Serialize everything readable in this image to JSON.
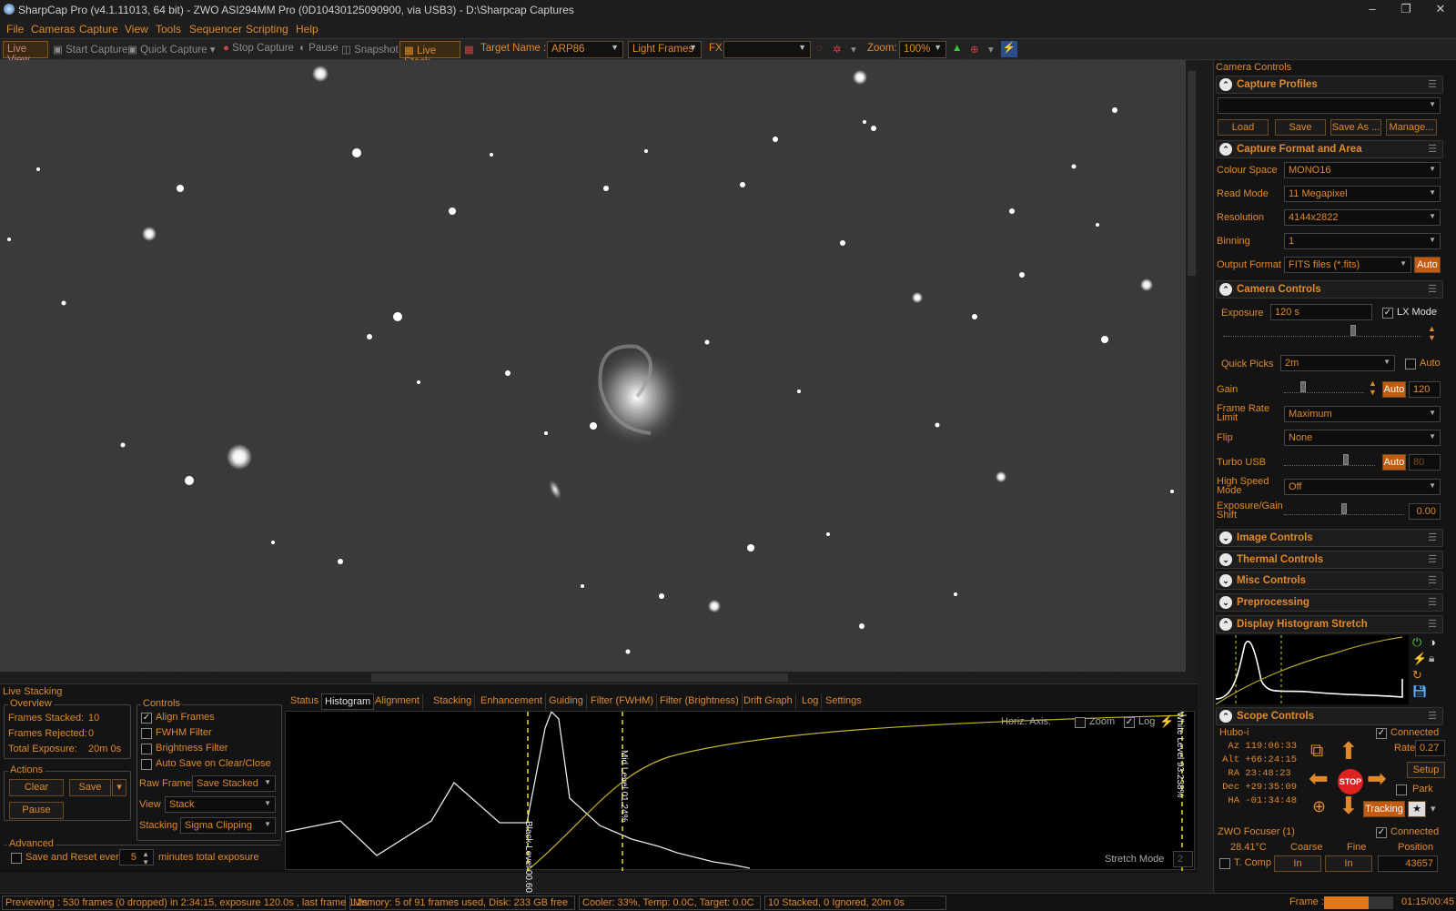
{
  "window": {
    "title": "SharpCap Pro (v4.1.11013, 64 bit) - ZWO ASI294MM Pro (0D10430125090900, via USB3) - D:\\Sharpcap Captures"
  },
  "menu": [
    "File",
    "Cameras",
    "Capture",
    "View",
    "Tools",
    "Sequencer",
    "Scripting",
    "Help"
  ],
  "toolbar": {
    "live_view": "Live View",
    "start_capture": "Start Capture",
    "quick_capture": "Quick Capture",
    "stop_capture": "Stop Capture",
    "pause": "Pause",
    "snapshot": "Snapshot",
    "live_stack": "Live Stack",
    "target_label": "Target Name :",
    "target_value": "ARP86",
    "frame_type": "Light Frames",
    "fx_label": "FX",
    "fx_value": "",
    "zoom_label": "Zoom:",
    "zoom_value": "100%"
  },
  "right_panel": {
    "title": "Camera Controls",
    "capture_profiles": {
      "title": "Capture Profiles",
      "profile_value": "",
      "load": "Load",
      "save": "Save",
      "save_as": "Save As ...",
      "manage": "Manage..."
    },
    "capture_format": {
      "title": "Capture Format and Area",
      "colour_space_label": "Colour Space",
      "colour_space": "MONO16",
      "read_mode_label": "Read Mode",
      "read_mode": "11 Megapixel",
      "resolution_label": "Resolution",
      "resolution": "4144x2822",
      "binning_label": "Binning",
      "binning": "1",
      "output_format_label": "Output Format",
      "output_format": "FITS files (*.fits)",
      "auto": "Auto"
    },
    "camera_controls": {
      "title": "Camera Controls",
      "exposure_label": "Exposure",
      "exposure": "120 s",
      "lx_mode": "LX Mode",
      "quick_picks_label": "Quick Picks",
      "quick_picks": "2m",
      "quick_auto": "Auto",
      "gain_label": "Gain",
      "gain_auto": "Auto",
      "gain": "120",
      "frame_rate_label": "Frame Rate Limit",
      "frame_rate": "Maximum",
      "flip_label": "Flip",
      "flip": "None",
      "turbo_label": "Turbo USB",
      "turbo_auto": "Auto",
      "turbo": "80",
      "high_speed_label": "High Speed Mode",
      "high_speed": "Off",
      "shift_label": "Exposure/Gain Shift",
      "shift": "0.00"
    },
    "sections": {
      "image": "Image Controls",
      "thermal": "Thermal Controls",
      "misc": "Misc Controls",
      "preproc": "Preprocessing",
      "histogram": "Display Histogram Stretch",
      "scope": "Scope Controls"
    },
    "scope": {
      "mount": "Hubo-i",
      "connected": "Connected",
      "az_label": "Az",
      "az": "119:06:33",
      "alt_label": "Alt",
      "alt": "+66:24:15",
      "ra_label": "RA",
      "ra": "23:48:23",
      "dec_label": "Dec",
      "dec": "+29:35:09",
      "ha_label": "HA",
      "ha": "-01:34:48",
      "rate_label": "Rate:",
      "rate": "0.27",
      "setup": "Setup",
      "park": "Park",
      "tracking": "Tracking",
      "stop": "STOP"
    },
    "focuser": {
      "name": "ZWO Focuser (1)",
      "connected": "Connected",
      "temp": "28.41°C",
      "coarse": "Coarse",
      "fine": "Fine",
      "position_label": "Position",
      "tcomp": "T. Comp",
      "in1": "In",
      "in2": "In",
      "position": "43657"
    }
  },
  "live_stacking": {
    "title": "Live Stacking",
    "overview": {
      "title": "Overview",
      "stacked_label": "Frames Stacked:",
      "stacked": "10",
      "rejected_label": "Frames Rejected:",
      "rejected": "0",
      "total_label": "Total Exposure:",
      "total": "20m 0s"
    },
    "actions": {
      "title": "Actions",
      "clear": "Clear",
      "save": "Save",
      "pause": "Pause"
    },
    "advanced": {
      "title": "Advanced",
      "save_reset": "Save and Reset every",
      "minutes": "5",
      "minutes_suffix": "minutes total exposure"
    },
    "controls": {
      "title": "Controls",
      "align": "Align Frames",
      "fwhm": "FWHM Filter",
      "brightness": "Brightness Filter",
      "autosave": "Auto Save on Clear/Close",
      "raw_label": "Raw Frames",
      "raw": "Save Stacked",
      "view_label": "View",
      "view": "Stack",
      "stacking_label": "Stacking",
      "stacking": "Sigma Clipping"
    },
    "tabs": [
      "Status",
      "Histogram",
      "Alignment",
      "Stacking",
      "Enhancement",
      "Guiding",
      "Filter (FWHM)",
      "Filter (Brightness)",
      "Drift Graph",
      "Log",
      "Settings"
    ],
    "histogram": {
      "horiz_axis": "Horiz. Axis:",
      "zoom": "Zoom",
      "log": "Log",
      "black": "Black Level 00.60%",
      "mid": "Mid Level 01.24%",
      "white": "White Level 93.238%",
      "stretch_mode": "Stretch Mode",
      "stretch_value": "2"
    }
  },
  "status_bar": {
    "preview": "Previewing : 530 frames (0 dropped) in 2:34:15, exposure 120.0s , last frame 1.2s",
    "memory": "Memory: 5 of 91 frames used, Disk: 233 GB free",
    "cooler": "Cooler: 33%, Temp: 0.0C, Target: 0.0C",
    "stack": "10 Stacked, 0 Ignored, 20m 0s",
    "frame_label": "Frame :",
    "frame_progress": 0.65,
    "time": "01:15/00:45"
  },
  "colors": {
    "accent": "#e08a2c",
    "active": "#c35a10",
    "background": "#141414"
  }
}
